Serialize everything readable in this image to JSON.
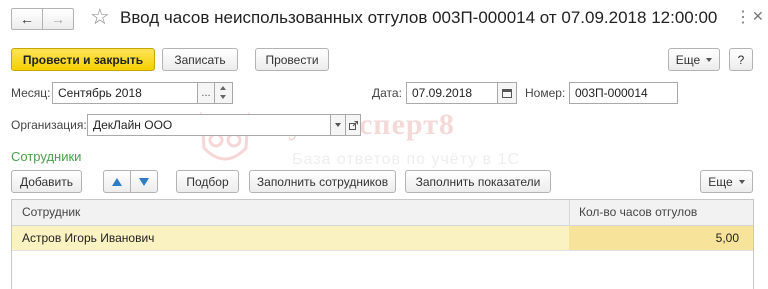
{
  "nav": {
    "back": "←",
    "forward": "→",
    "star": "☆"
  },
  "header": {
    "title": "Ввод часов неиспользованных отгулов 003П-000014 от 07.09.2018 12:00:00",
    "more": "⋮",
    "close": "✕"
  },
  "toolbar": {
    "post_close": "Провести и закрыть",
    "save": "Записать",
    "post": "Провести",
    "more": "Еще",
    "help": "?"
  },
  "form": {
    "month_label": "Месяц:",
    "month_value": "Сентябрь 2018",
    "month_dots": "...",
    "date_label": "Дата:",
    "date_value": "07.09.2018",
    "number_label": "Номер:",
    "number_value": "003П-000014",
    "org_label": "Организация:",
    "org_value": "ДекЛайн ООО"
  },
  "watermark": {
    "brand": "БухЭксперт8",
    "tagline": "База ответов по учёту в 1С"
  },
  "section": {
    "title": "Сотрудники"
  },
  "table_toolbar": {
    "add": "Добавить",
    "pick": "Подбор",
    "fill_employees": "Заполнить сотрудников",
    "fill_indicators": "Заполнить показатели",
    "more": "Еще"
  },
  "table": {
    "headers": {
      "employee": "Сотрудник",
      "hours": "Кол-во часов отгулов"
    },
    "rows": [
      {
        "employee": "Астров Игорь Иванович",
        "hours": "5,00"
      }
    ]
  },
  "colors": {
    "section_title": "#4aa04a",
    "primary_button": "#f5d000",
    "selected_row": "#fbf2c2"
  }
}
